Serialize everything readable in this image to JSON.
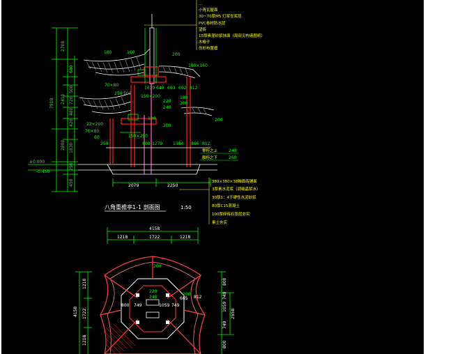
{
  "title": "八角重檐亭1-1 剖面图",
  "scale": "1:50",
  "callouts_top": [
    "…",
    "小青瓦屋面",
    "30~70厚M5 灯浆坐浆层",
    "PVC卷材防水层",
    "望砖",
    "15厚素混砂浆抹面（局部见构造图纸）",
    "木椽子",
    "仿形布置檩"
  ],
  "callouts_bottom": [
    "380×380×38釉面砖铺面",
    "3厚素水泥浆（调细晶浆水）",
    "30厚1：4干硬性水泥砂浆",
    "80厚C15混凝土",
    "100厚碎砖石垫层夯实",
    "素土夯实"
  ],
  "left_dims": [
    "2708",
    "7918",
    "2410",
    "680",
    "500",
    "480",
    "720",
    "420",
    "2800",
    "1830",
    "250",
    "450"
  ],
  "elevations": [
    "±0.000",
    "-0.450"
  ],
  "section_labels": [
    "180",
    "160",
    "200",
    "180×160",
    "70×80",
    "250",
    "500",
    "1639",
    "640",
    "693",
    "692",
    "812",
    "150×200",
    "180",
    "200",
    "220",
    "240",
    "22×200",
    "70×80",
    "150×250",
    "60",
    "200",
    "120",
    "250",
    "800",
    "1279",
    "1384",
    "866",
    "812",
    "200"
  ],
  "bottom_dims": [
    "2079",
    "2250"
  ],
  "beam_notes": [
    {
      "label": "脊桁之上",
      "value": "240"
    },
    {
      "label": "额桁之下",
      "value": "260"
    }
  ],
  "plan_top_dims": {
    "total": "4158",
    "parts": [
      "1218",
      "1722",
      "1218"
    ]
  },
  "plan_left_dims": {
    "total": "4158",
    "parts": [
      "1218",
      "1722",
      "1218"
    ]
  },
  "plan_right_dims": {
    "total": "2558",
    "parts": [
      "800",
      "1059",
      "749",
      "749",
      "800"
    ]
  },
  "plan_labels": [
    "200",
    "220",
    "240",
    "800",
    "749",
    "1059",
    "749",
    "812",
    "665",
    "200"
  ],
  "colors": {
    "background": "#000000",
    "outline": "#ffffff",
    "dims": "#00ff00",
    "notes": "#ffff00",
    "structure": "#ff2020",
    "accent": "#00ffff",
    "roof": "#c8c8c8"
  }
}
